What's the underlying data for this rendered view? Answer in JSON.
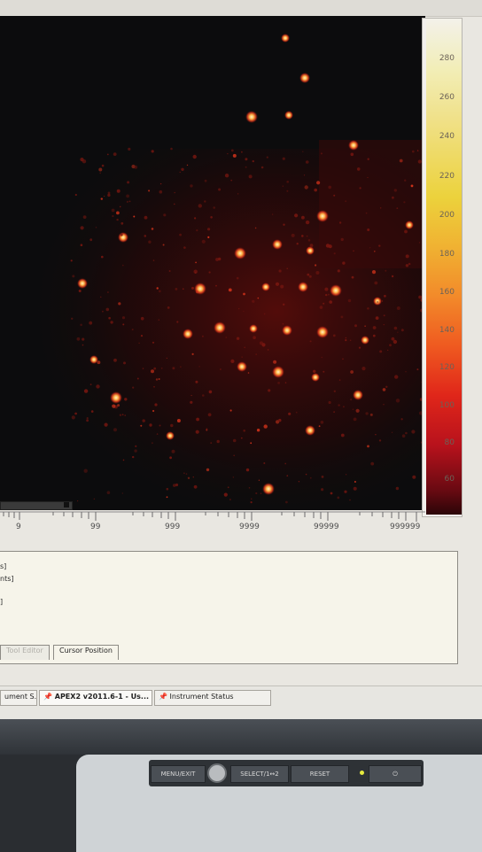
{
  "colorbar": {
    "labels": [
      "280",
      "260",
      "240",
      "220",
      "200",
      "180",
      "160",
      "140",
      "120",
      "100",
      "80",
      "60"
    ]
  },
  "scale": {
    "tick_labels": [
      "9",
      "99",
      "999",
      "9999",
      "99999",
      "999999"
    ]
  },
  "panel": {
    "lines": [
      "s]",
      "nts]",
      "]"
    ]
  },
  "tabs": {
    "tool_editor": "Tool Editor",
    "cursor_position": "Cursor Position"
  },
  "taskbar": {
    "item1": "ument S...",
    "item2": "APEX2 v2011.6-1 - Us...",
    "item3": "Instrument Status"
  },
  "monitor": {
    "menu_exit": "MENU/EXIT",
    "select": "SELECT/1↔2",
    "reset": "RESET",
    "power_icon": "⏻"
  }
}
